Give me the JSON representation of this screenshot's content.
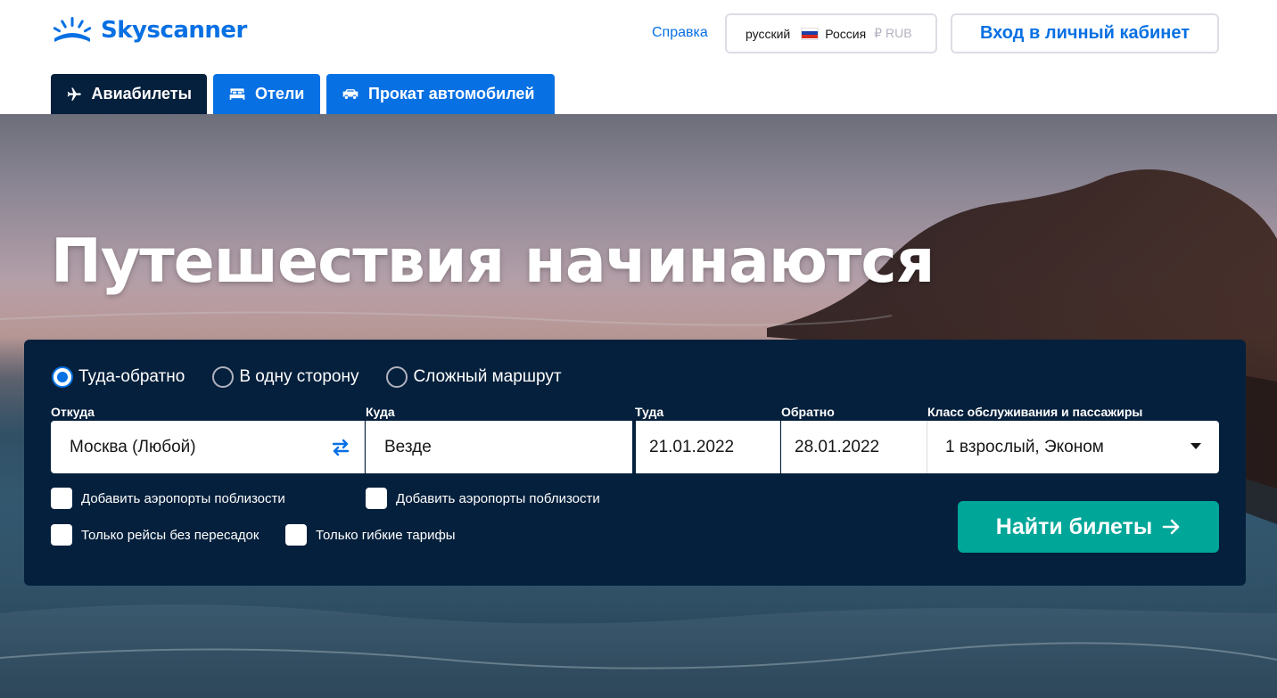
{
  "header": {
    "logo_text": "Skyscanner",
    "logo_icon": "sunrise-logo-icon",
    "help_label": "Справка",
    "locale": {
      "language": "русский",
      "country": "Россия",
      "currency": "₽ RUB",
      "flag_icon": "russia-flag-icon"
    },
    "login_label": "Вход в личный кабинет"
  },
  "tabs": [
    {
      "label": "Авиабилеты",
      "icon": "plane-icon",
      "active": true
    },
    {
      "label": "Отели",
      "icon": "bed-icon",
      "active": false
    },
    {
      "label": "Прокат автомобилей",
      "icon": "car-icon",
      "active": false
    }
  ],
  "hero": {
    "title": "Путешествия начинаются"
  },
  "search": {
    "trip_types": [
      {
        "label": "Туда-обратно",
        "checked": true
      },
      {
        "label": "В одну сторону",
        "checked": false
      },
      {
        "label": "Сложный маршрут",
        "checked": false
      }
    ],
    "labels": {
      "from": "Откуда",
      "to": "Куда",
      "depart": "Туда",
      "return": "Обратно",
      "class": "Класс обслуживания и пассажиры"
    },
    "values": {
      "from": "Москва (Любой)",
      "to": "Везде",
      "depart": "21.01.2022",
      "return": "28.01.2022",
      "class": "1 взрослый, Эконом"
    },
    "checkboxes": [
      {
        "label": "Добавить аэропорты поблизости",
        "checked": false
      },
      {
        "label": "Добавить аэропорты поблизости",
        "checked": false
      },
      {
        "label": "Только рейсы без пересадок",
        "checked": false
      },
      {
        "label": "Только гибкие тарифы",
        "checked": false
      }
    ],
    "submit_label": "Найти билеты"
  },
  "colors": {
    "brand_blue": "#0770e3",
    "panel_navy": "#05203c",
    "search_teal": "#00a698"
  }
}
